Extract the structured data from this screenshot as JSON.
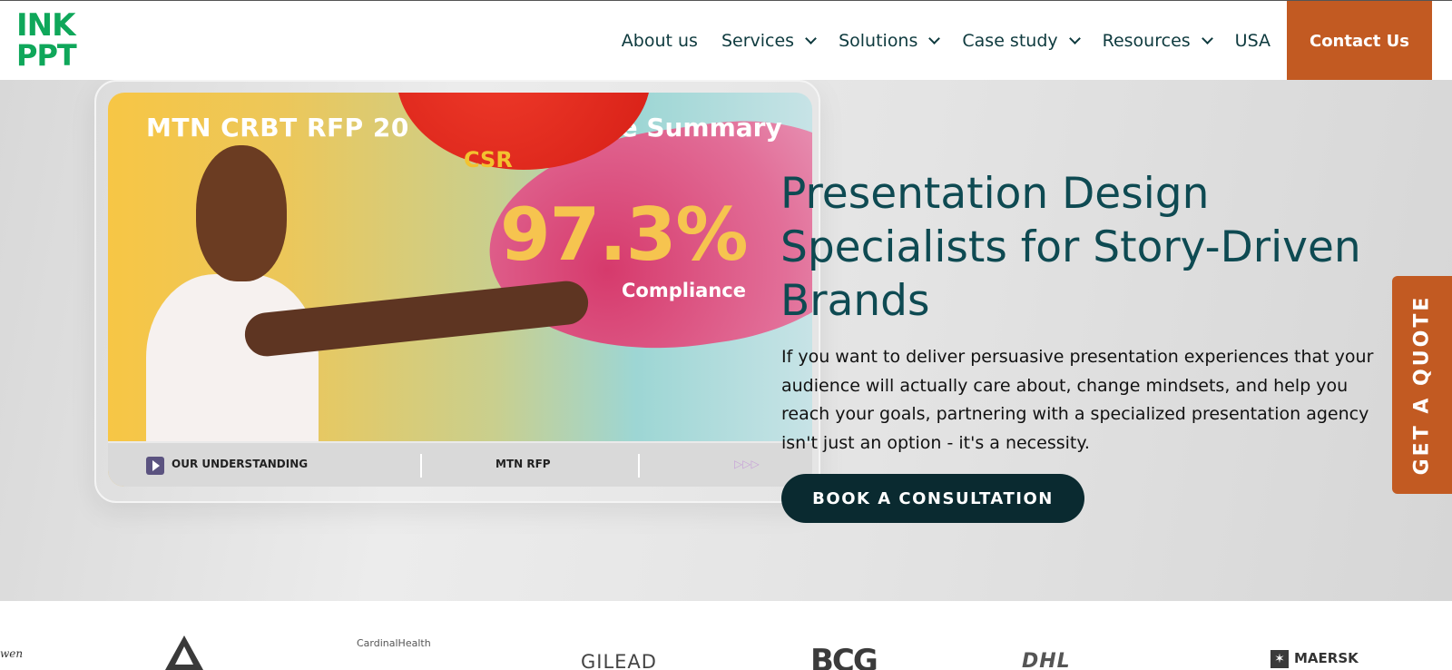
{
  "brand": {
    "logo_line1": "INK",
    "logo_line2": "PPT"
  },
  "nav": {
    "items": [
      {
        "label": "About us"
      },
      {
        "label": "Services"
      },
      {
        "label": "Solutions"
      },
      {
        "label": "Case study"
      },
      {
        "label": "Resources"
      },
      {
        "label": "USA"
      }
    ],
    "contact_label": "Contact Us"
  },
  "hero": {
    "heading": "Presentation Design Specialists for Story-Driven Brands",
    "description": "If you want to deliver persuasive presentation experiences that your audience will actually care about, change mindsets, and help you reach your goals, partnering with a specialized presentation agency isn't just an option - it's a necessity.",
    "cta_label": "BOOK A CONSULTATION",
    "slide": {
      "title_left": "MTN CRBT RFP 20",
      "title_right": "ce Summary",
      "csr": "CSR",
      "percent": "97.3%",
      "compliance": "Compliance",
      "footer_left": "OUR UNDERSTANDING",
      "footer_mid": "MTN RFP"
    }
  },
  "quote_tab": {
    "label": "GET A QUOTE"
  },
  "client_logos": {
    "ween": "wen",
    "cardinal": "CardinalHealth",
    "gilead": "GILEAD",
    "bcg": "BCG",
    "dhl": "DHL",
    "maersk": "MAERSK"
  },
  "colors": {
    "brand_green": "#0fa75a",
    "accent_orange": "#c25a22",
    "heading_teal": "#0e4a52",
    "cta_dark": "#0a2a30"
  }
}
